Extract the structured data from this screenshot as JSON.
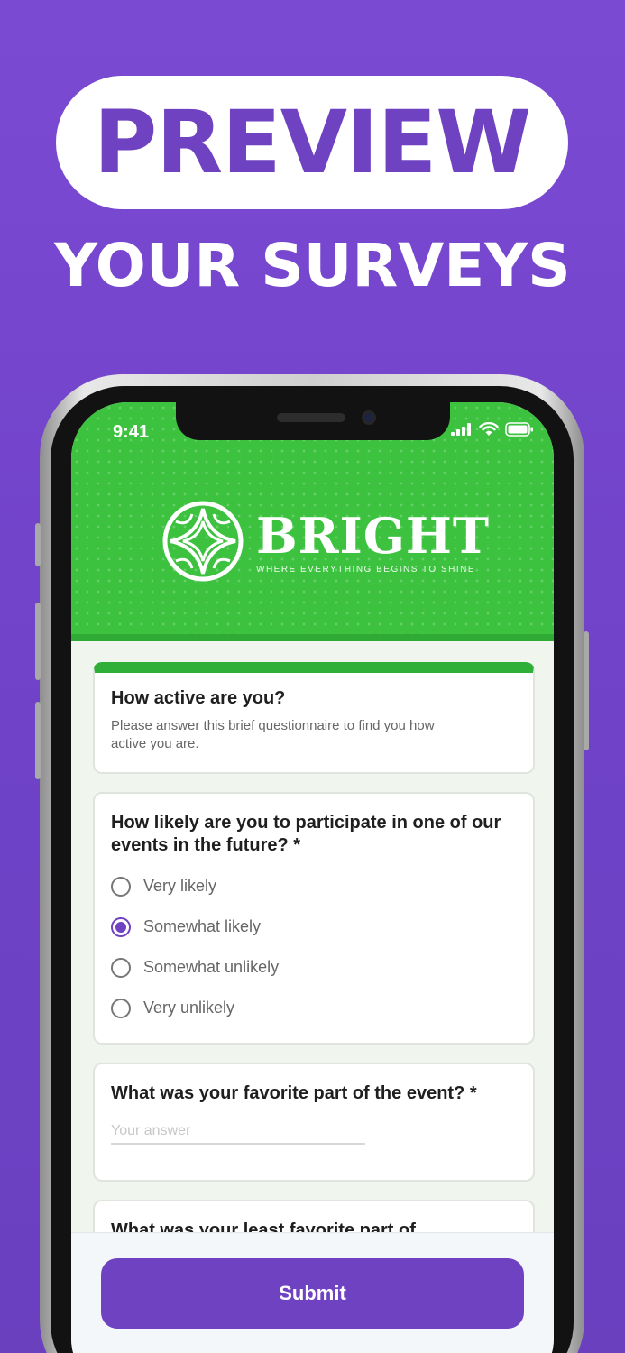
{
  "banner": {
    "headline": "PREVIEW",
    "subheadline": "YOUR SURVEYS"
  },
  "status_bar": {
    "time": "9:41",
    "icons": [
      "signal-icon",
      "wifi-icon",
      "battery-icon"
    ]
  },
  "brand": {
    "name": "BRIGHT",
    "tagline": "WHERE EVERYTHING BEGINS TO SHINE",
    "header_color": "#3cc23f"
  },
  "survey": {
    "title": "How active are you?",
    "description": "Please answer this brief questionnaire to find you how active you are."
  },
  "questions": [
    {
      "title": "How likely are you to participate in one of our events in the future? *",
      "options": [
        "Very likely",
        "Somewhat likely",
        "Somewhat unlikely",
        "Very unlikely"
      ],
      "selected": "Somewhat likely"
    },
    {
      "title": "What was your favorite part of the event? *",
      "placeholder": "Your answer"
    },
    {
      "title": "What was your least favorite part of"
    }
  ],
  "actions": {
    "submit_label": "Submit"
  },
  "colors": {
    "accent": "#6f42c1",
    "background": "#7b4ad3"
  }
}
